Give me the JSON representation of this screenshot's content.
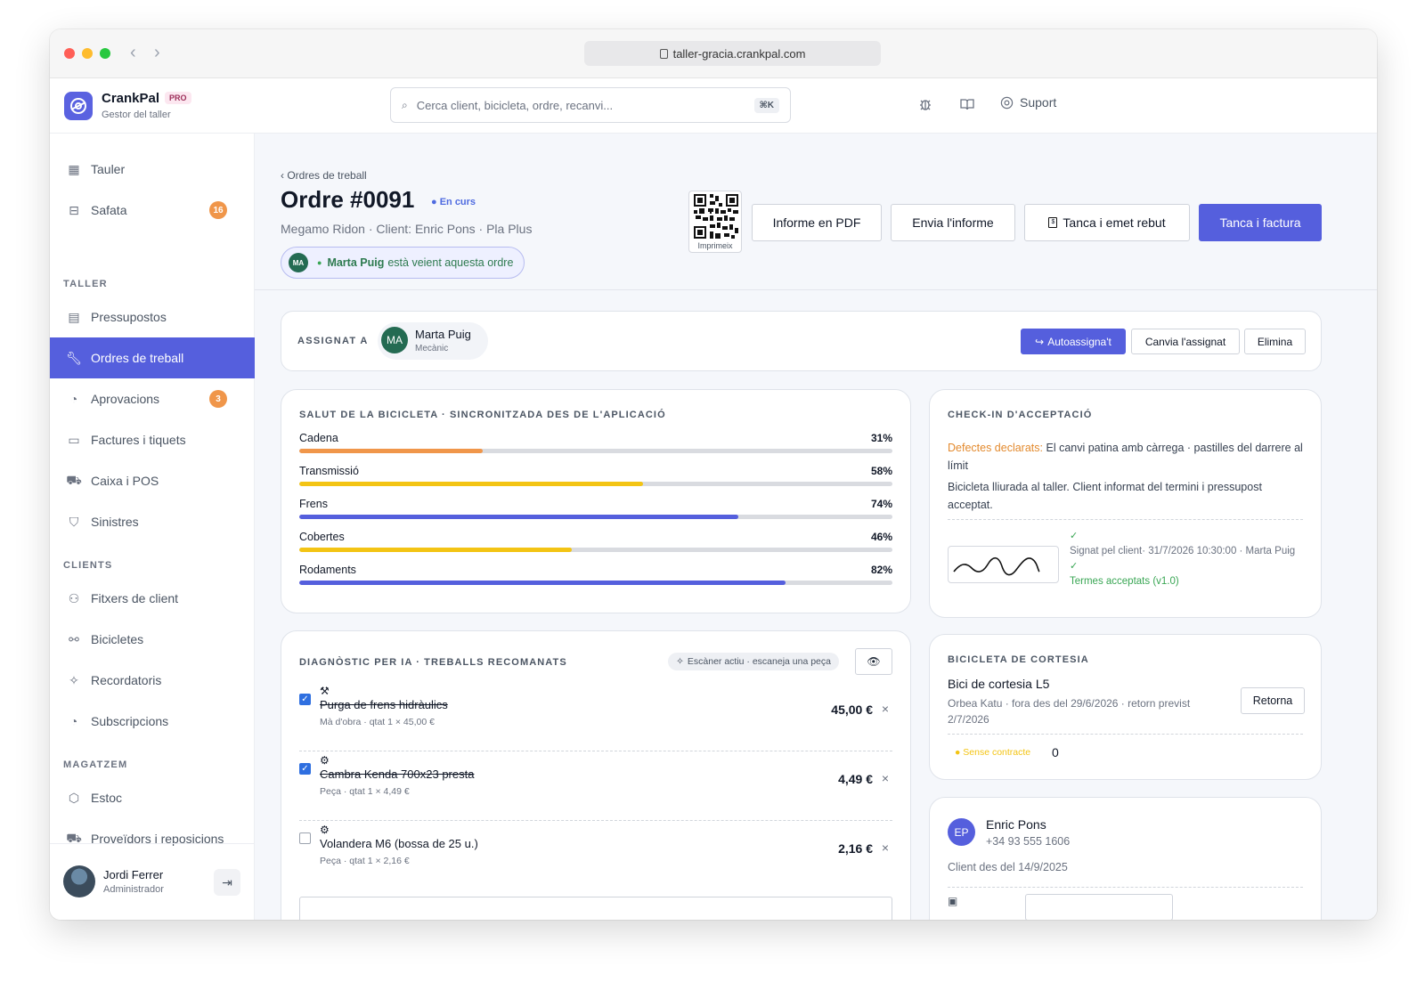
{
  "browser": {
    "url": "taller-gracia.crankpal.com"
  },
  "app": {
    "name": "CrankPal",
    "plan": "PRO",
    "subtitle": "Gestor del taller"
  },
  "search": {
    "placeholder": "Cerca client, bicicleta, ordre, recanvi...",
    "shortcut": "⌘K"
  },
  "topbar": {
    "support_label": "Suport"
  },
  "sidebar": {
    "items": [
      {
        "label": "Tauler",
        "icon": "dashboard-icon"
      },
      {
        "label": "Safata",
        "icon": "inbox-icon",
        "badge": "16"
      },
      {
        "label": "Pressupostos",
        "icon": "document-icon"
      },
      {
        "label": "Ordres de treball",
        "icon": "wrench-icon",
        "active": true
      },
      {
        "label": "Aprovacions",
        "icon": "check-circle-icon",
        "badge": "3"
      },
      {
        "label": "Factures i tiquets",
        "icon": "ticket-icon"
      },
      {
        "label": "Caixa i POS",
        "icon": "cart-icon"
      },
      {
        "label": "Sinistres",
        "icon": "shield-icon"
      },
      {
        "label": "Fitxers de client",
        "icon": "users-icon"
      },
      {
        "label": "Bicicletes",
        "icon": "bike-icon"
      },
      {
        "label": "Recordatoris",
        "icon": "sparkle-icon"
      },
      {
        "label": "Subscripcions",
        "icon": "check-circle-icon"
      },
      {
        "label": "Estoc",
        "icon": "box-icon"
      },
      {
        "label": "Proveïdors i reposicions",
        "icon": "truck-icon"
      }
    ],
    "sections": {
      "taller": "TALLER",
      "clients": "CLIENTS",
      "magatzem": "MAGATZEM"
    },
    "user": {
      "name": "Jordi Ferrer",
      "role": "Administrador"
    }
  },
  "order": {
    "breadcrumb": "‹ Ordres de treball",
    "title": "Ordre #0091",
    "status": "● En curs",
    "subtitle": "Megamo Ridon · Client: Enric Pons · Pla Plus",
    "viewer_initials": "MA",
    "viewer_name": "Marta Puig",
    "viewer_text": "està veient aquesta ordre",
    "qr_label": "Imprimeix",
    "buttons": {
      "pdf": "Informe en PDF",
      "send": "Envia l'informe",
      "close_receipt": "Tanca i emet rebut",
      "close_invoice": "Tanca i factura"
    }
  },
  "assign": {
    "label": "ASSIGNAT A",
    "initials": "MA",
    "name": "Marta Puig",
    "role": "Mecànic",
    "self_assign": "Autoassigna't",
    "change": "Canvia l'assignat",
    "delete": "Elimina"
  },
  "health": {
    "title": "SALUT DE LA BICICLETA · SINCRONITZADA DES DE L'APLICACIÓ",
    "items": [
      {
        "label": "Cadena",
        "value": 31,
        "display": "31%",
        "color": "#f0964a"
      },
      {
        "label": "Transmissió",
        "value": 58,
        "display": "58%",
        "color": "#f3c414"
      },
      {
        "label": "Frens",
        "value": 74,
        "display": "74%",
        "color": "#555fdd"
      },
      {
        "label": "Cobertes",
        "value": 46,
        "display": "46%",
        "color": "#f3c414"
      },
      {
        "label": "Rodaments",
        "value": 82,
        "display": "82%",
        "color": "#555fdd"
      }
    ]
  },
  "checkin": {
    "title": "CHECK-IN D'ACCEPTACIÓ",
    "defects_label": "Defectes declarats:",
    "defects_text": "El canvi patina amb càrrega · pastilles del darrere al límit",
    "note": "Bicicleta lliurada al taller. Client informat del termini i pressupost acceptat.",
    "signed": "Signat pel client· 31/7/2026 10:30:00 · Marta Puig",
    "terms": "Termes acceptats (v1.0)"
  },
  "diagnosis": {
    "title": "DIAGNÒSTIC PER IA · TREBALLS RECOMANATS",
    "scanner": "Escàner actiu · escaneja una peça",
    "jobs": [
      {
        "icon": "wrench-icon",
        "name": "Purga de frens hidràulics",
        "meta": "Mà d'obra · qtat 1 × 45,00 €",
        "price": "45,00 €",
        "checked": true
      },
      {
        "icon": "gear-icon",
        "name": "Cambra Kenda 700x23 presta",
        "meta": "Peça · qtat 1 × 4,49 €",
        "price": "4,49 €",
        "checked": true
      },
      {
        "icon": "gear-icon",
        "name": "Volandera M6 (bossa de 25 u.)",
        "meta": "Peça · qtat 1 × 2,16 €",
        "price": "2,16 €",
        "checked": false
      }
    ]
  },
  "courtesy": {
    "title": "BICICLETA DE CORTESIA",
    "bike": "Bici de cortesia L5",
    "detail": "Orbea Katu · fora des del 29/6/2026 · retorn previst 2/7/2026",
    "return": "Retorna",
    "contract": "● Sense contracte",
    "count": "0"
  },
  "customer": {
    "initials": "EP",
    "name": "Enric Pons",
    "phone": "+34 93 555 1606",
    "since": "Client des del 14/9/2025"
  },
  "colors": {
    "accent": "#555fdd",
    "orange": "#f0964a",
    "yellow": "#f3c414",
    "green": "#39a654"
  }
}
